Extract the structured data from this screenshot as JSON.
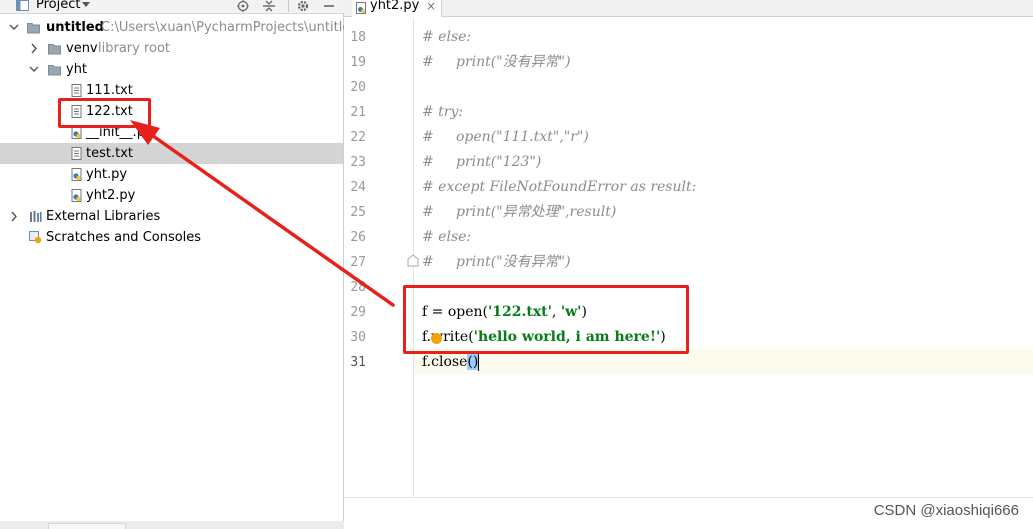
{
  "project_panel": {
    "toolbar_title": "Project",
    "tree": [
      {
        "label": "untitled",
        "hint": "C:\\Users\\xuan\\PycharmProjects\\untitled",
        "icon": "folder-icon"
      },
      {
        "label": "venv",
        "hint": "library root",
        "icon": "folder-icon"
      },
      {
        "label": "yht",
        "icon": "folder-icon"
      },
      {
        "label": "111.txt",
        "icon": "text-file-icon"
      },
      {
        "label": "122.txt",
        "icon": "text-file-icon"
      },
      {
        "label": "__init__.py",
        "icon": "python-file-icon"
      },
      {
        "label": "test.txt",
        "icon": "text-file-icon"
      },
      {
        "label": "yht.py",
        "icon": "python-file-icon"
      },
      {
        "label": "yht2.py",
        "icon": "python-file-icon"
      },
      {
        "label": "External Libraries",
        "icon": "library-icon"
      },
      {
        "label": "Scratches and Consoles",
        "icon": "scratches-icon"
      }
    ]
  },
  "editor": {
    "tab_label": "yht2.py",
    "tab_close": "×",
    "line_numbers": [
      "18",
      "19",
      "20",
      "21",
      "22",
      "23",
      "24",
      "25",
      "26",
      "27",
      "28",
      "29",
      "30",
      "31"
    ],
    "lines": [
      "# else:",
      "#     print(\"没有异常\")",
      "",
      "# try:",
      "#     open(\"111.txt\",\"r\")",
      "#     print(\"123\")",
      "# except FileNotFoundError as result:",
      "#     print(\"异常处理\",result)",
      "# else:",
      "#     print(\"没有异常\")",
      ""
    ],
    "code_29": {
      "pre": "f = open(",
      "s1": "'122.txt'",
      "mid": ", ",
      "s2": "'w'",
      "post": ")"
    },
    "code_30": {
      "pre": "f.write(",
      "s1": "'hello world, i am here!'",
      "post": ")"
    },
    "code_31": {
      "pre": "f.close",
      "paren": "()"
    }
  },
  "watermark": "CSDN @xiaoshiqi666",
  "colors": {
    "annotation_red": "#e8201c",
    "string_green": "#067d17",
    "comment_gray": "#8c8c8c",
    "selection_gray": "#d4d4d4"
  }
}
